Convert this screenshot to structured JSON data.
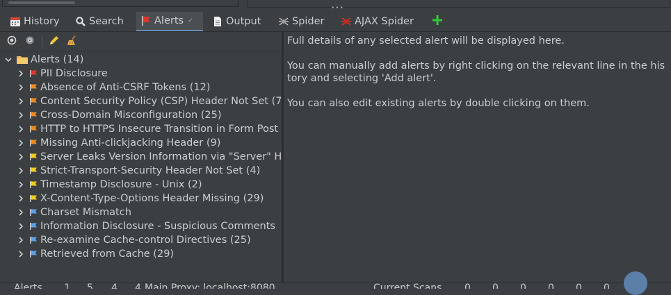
{
  "tabs": [
    {
      "label": "History",
      "icon": "history-icon",
      "active": false
    },
    {
      "label": "Search",
      "icon": "search-icon",
      "active": false
    },
    {
      "label": "Alerts",
      "icon": "alert-flag-icon",
      "active": true,
      "suffix": "✓"
    },
    {
      "label": "Output",
      "icon": "output-document-icon",
      "active": false
    },
    {
      "label": "Spider",
      "icon": "spider-icon",
      "active": false
    },
    {
      "label": "AJAX Spider",
      "icon": "ajax-spider-icon",
      "active": false
    }
  ],
  "toolbar": {
    "icons": [
      "filter-icon",
      "scope-icon",
      "edit-pencil-icon",
      "broom-clean-icon"
    ]
  },
  "tree": {
    "root_label": "Alerts (14)",
    "items": [
      {
        "label": "PII Disclosure",
        "risk": "high"
      },
      {
        "label": "Absence of Anti-CSRF Tokens (12)",
        "risk": "medium"
      },
      {
        "label": "Content Security Policy (CSP) Header Not Set (7",
        "risk": "medium"
      },
      {
        "label": "Cross-Domain Misconfiguration (25)",
        "risk": "medium"
      },
      {
        "label": "HTTP to HTTPS Insecure Transition in Form Post",
        "risk": "medium"
      },
      {
        "label": "Missing Anti-clickjacking Header (9)",
        "risk": "medium"
      },
      {
        "label": "Server Leaks Version Information via \"Server\" H",
        "risk": "low"
      },
      {
        "label": "Strict-Transport-Security Header Not Set (4)",
        "risk": "low"
      },
      {
        "label": "Timestamp Disclosure - Unix (2)",
        "risk": "low"
      },
      {
        "label": "X-Content-Type-Options Header Missing (29)",
        "risk": "low"
      },
      {
        "label": "Charset Mismatch",
        "risk": "info"
      },
      {
        "label": "Information Disclosure - Suspicious Comments",
        "risk": "info"
      },
      {
        "label": "Re-examine Cache-control Directives (25)",
        "risk": "info"
      },
      {
        "label": "Retrieved from Cache (29)",
        "risk": "info"
      }
    ]
  },
  "details": {
    "line1": "Full details of any selected alert will be displayed here.",
    "line2": "You can manually add alerts by right clicking on the relevant line in the his tory and selecting 'Add alert'.",
    "line3": "You can also edit existing alerts by double clicking on them."
  },
  "status": {
    "alerts_label": "Alerts",
    "high": "1",
    "medium": "5",
    "low": "4",
    "info": "4",
    "proxy_label": "Main Proxy: localhost:8080",
    "scans_label": "Current Scans",
    "scan_counts": [
      "0",
      "0",
      "0",
      "0",
      "0",
      "0"
    ]
  },
  "colors": {
    "high": "#e0342c",
    "medium": "#f08a1c",
    "low": "#f2cf1a",
    "info": "#5da3e6",
    "add": "#2fcc3a",
    "folder": "#e8b95a"
  }
}
